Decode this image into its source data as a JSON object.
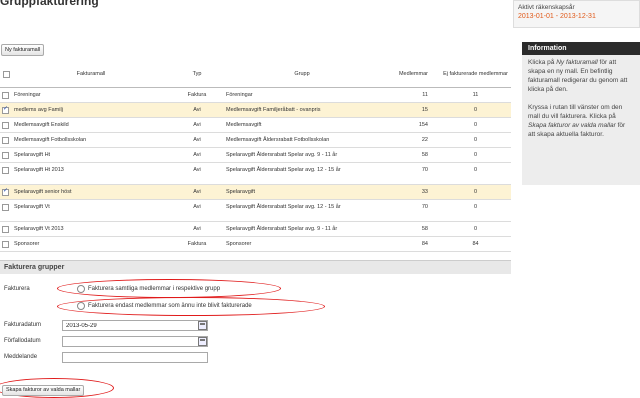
{
  "page": {
    "title": "Gruppfakturering"
  },
  "toolbar": {
    "new_template_label": "Ny fakturamall"
  },
  "period": {
    "label": "Aktivt räkenskapsår",
    "value": "2013-01-01 - 2013-12-31"
  },
  "info": {
    "title": "Information",
    "p1": {
      "a": "Klicka på ",
      "em": "Ny fakturamall",
      "b": " för att skapa en ny mall. En befintlig fakturamall redigerar du genom att klicka på den."
    },
    "p2": {
      "a": "Kryssa i rutan till vänster om den mall du vill fakturera. Klicka på ",
      "em": "Skapa fakturor av valda mallar",
      "b": " för att skapa aktuella fakturor."
    }
  },
  "table": {
    "headers": {
      "name": "Fakturamall",
      "type": "Typ",
      "group": "Grupp",
      "members": "Medlemmar",
      "not_invoiced": "Ej fakturerade medlemmar"
    },
    "rows": [
      {
        "name": "Föreningar",
        "type": "Faktura",
        "group": "Föreningar",
        "members": "11",
        "not_invoiced": "11",
        "checked": false,
        "highlight": false
      },
      {
        "name": "medlems avg Familj",
        "type": "Avi",
        "group": "Medlemsavgift Familjeråbatt - ovanpris",
        "members": "15",
        "not_invoiced": "0",
        "checked": true,
        "highlight": true
      },
      {
        "name": "Medlemsavgift Enskild",
        "type": "Avi",
        "group": "Medlemsavgift",
        "members": "154",
        "not_invoiced": "0",
        "checked": false,
        "highlight": false
      },
      {
        "name": "Medlemsavgift Fotbollsskolan",
        "type": "Avi",
        "group": "Medlemsavgift Åldersrabatt Fotbollsskolan",
        "members": "22",
        "not_invoiced": "0",
        "checked": false,
        "highlight": false
      },
      {
        "name": "Spelaravgift Ht",
        "type": "Avi",
        "group": "Spelaravgift Åldersrabatt Spelar avg. 9 - 11 år",
        "members": "58",
        "not_invoiced": "0",
        "checked": false,
        "highlight": false
      },
      {
        "name": "Spelaravgift Ht 2013",
        "type": "Avi",
        "group": "Spelaravgift Åldersrabatt Spelar avg. 12 - 15 år",
        "members": "70",
        "not_invoiced": "0",
        "checked": false,
        "highlight": false,
        "tall": true
      },
      {
        "name": "Spelaravgift senior höst",
        "type": "Avi",
        "group": "Spelaravgift",
        "members": "33",
        "not_invoiced": "0",
        "checked": true,
        "highlight": true
      },
      {
        "name": "Spelaravgift Vt",
        "type": "Avi",
        "group": "Spelaravgift Åldersrabatt Spelar avg. 12 - 15 år",
        "members": "70",
        "not_invoiced": "0",
        "checked": false,
        "highlight": false,
        "tall": true
      },
      {
        "name": "Spelaravgift Vt 2013",
        "type": "Avi",
        "group": "Spelaravgift Åldersrabatt Spelar avg. 9 - 11 år",
        "members": "58",
        "not_invoiced": "0",
        "checked": false,
        "highlight": false
      },
      {
        "name": "Sponsorer",
        "type": "Faktura",
        "group": "Sponsorer",
        "members": "84",
        "not_invoiced": "84",
        "checked": false,
        "highlight": false
      }
    ]
  },
  "form": {
    "section_title": "Fakturera grupper",
    "invoice_label": "Fakturera",
    "option_all": "Fakturera samtliga medlemmar i respektive grupp",
    "option_not_invoiced": "Fakturera endast medlemmar som ännu inte blivit fakturerade",
    "invoice_date_label": "Fakturadatum",
    "invoice_date_value": "2013-05-29",
    "due_date_label": "Förfallodatum",
    "due_date_value": "",
    "message_label": "Meddelande",
    "message_value": ""
  },
  "actions": {
    "create_label": "Skapa fakturor av valda mallar"
  }
}
